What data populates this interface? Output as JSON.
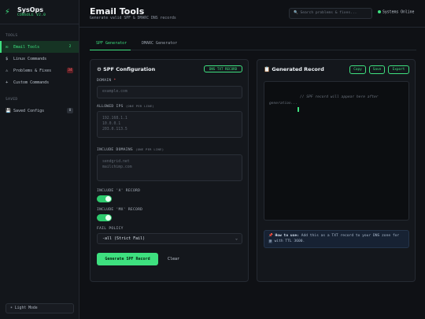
{
  "app": {
    "name": "SysOps",
    "subtitle": "CONSOLE V2.0"
  },
  "sidebar": {
    "tools_label": "TOOLS",
    "items": [
      {
        "icon": "✉",
        "label": "Email Tools",
        "badge": "2"
      },
      {
        "icon": "$",
        "label": "Linux Commands",
        "badge": ""
      },
      {
        "icon": "⚠",
        "label": "Problems & Fixes",
        "badge": "34"
      },
      {
        "icon": "+",
        "label": "Custom Commands",
        "badge": ""
      }
    ],
    "saved_label": "SAVED",
    "saved": {
      "icon": "💾",
      "label": "Saved Configs",
      "badge": "0"
    },
    "light_mode": "☀ Light Mode"
  },
  "header": {
    "title": "Email Tools",
    "subtitle": "Generate valid SPF & DMARC DNS records",
    "search_placeholder": "🔍 Search problems & fixes...",
    "status": "Systems Online"
  },
  "tabs": [
    "SPF Generator",
    "DMARC Generator"
  ],
  "spf": {
    "title": "⚙ SPF Configuration",
    "badge": "DNS TXT RECORD",
    "domain_label": "DOMAIN",
    "domain_req": "*",
    "domain_placeholder": "example.com",
    "ips_label": "ALLOWED IPS",
    "ips_hint": "(ONE PER LINE)",
    "ips_placeholder": [
      "192.168.1.1",
      "10.0.0.1",
      "203.0.113.5"
    ],
    "incl_label": "INCLUDE DOMAINS",
    "incl_hint": "(ONE PER LINE)",
    "incl_placeholder": [
      "sendgrid.net",
      "mailchimp.com"
    ],
    "a_label": "INCLUDE 'A' RECORD",
    "a_on": true,
    "mx_label": "INCLUDE 'MX' RECORD",
    "mx_on": true,
    "policy_label": "FAIL POLICY",
    "policy_value": "-all (Strict Fail)",
    "generate": "Generate SPF Record",
    "clear": "Clear"
  },
  "record": {
    "title": "📋 Generated Record",
    "copy": "Copy",
    "save": "Save",
    "export": "Export",
    "placeholder": "// SPF record will appear here after generation...",
    "hint_bold": "📌 How to use:",
    "hint_text": "Add this as a TXT record to your DNS zone for",
    "hint_code": "@",
    "hint_tail": "with TTL 3600."
  }
}
